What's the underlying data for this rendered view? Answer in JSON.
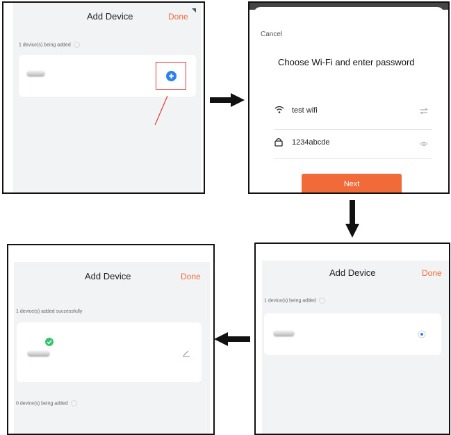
{
  "panel1": {
    "title": "Add Device",
    "done": "Done",
    "status": "1 device(s) being added",
    "icons": [
      "device-icon",
      "plus-circle-icon"
    ]
  },
  "panel2": {
    "cancel": "Cancel",
    "heading": "Choose Wi-Fi and enter password",
    "wifi_name": "test wifi",
    "password": "1234abcde",
    "next": "Next",
    "icons": [
      "wifi-icon",
      "swap-icon",
      "lock-icon",
      "eye-icon"
    ]
  },
  "panel3": {
    "title": "Add Device",
    "done": "Done",
    "status": "1 device(s) being added",
    "icons": [
      "device-icon",
      "radio-selected-icon"
    ]
  },
  "panel4": {
    "title": "Add Device",
    "done": "Done",
    "status_success": "1 device(s) added successfully",
    "status_adding": "0 device(s) being added",
    "icons": [
      "device-icon",
      "check-badge-icon",
      "edit-icon"
    ]
  },
  "colors": {
    "accent": "#f06a3a",
    "plus": "#2f7ff0",
    "highlight": "#e53935",
    "success": "#35c46b"
  }
}
